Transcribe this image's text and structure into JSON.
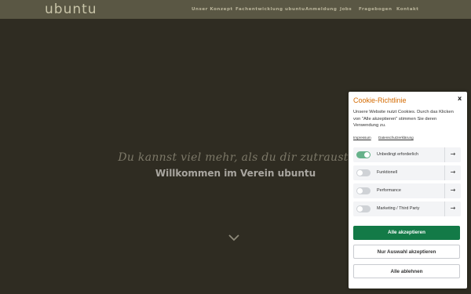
{
  "header": {
    "logo": "ubuntu",
    "nav": [
      "Unser Konzept",
      "Fachentwicklung ubuntu",
      "Anmeldung",
      "Jobs",
      "Fragebogen",
      "Kontakt"
    ]
  },
  "hero": {
    "tagline": "Du kannst viel mehr, als du dir zutraust!",
    "welcome": "Willkommen im Verein ubuntu"
  },
  "cookie": {
    "title": "Cookie-Richtlinie",
    "close": "x",
    "text": "Unsere Website nutzt Cookies. Durch das Klicken von \"Alle akzeptieren\" stimmen Sie deren Verwendung zu.",
    "links": [
      "Impressum",
      "Datenschutzerklärung"
    ],
    "options": [
      {
        "label": "Unbedingt erforderlich",
        "enabled": true
      },
      {
        "label": "Funktionell",
        "enabled": false
      },
      {
        "label": "Performance",
        "enabled": false
      },
      {
        "label": "Marketing / Third Party",
        "enabled": false
      }
    ],
    "arrow": "→",
    "buttons": {
      "accept_all": "Alle akzeptieren",
      "accept_selection": "Nur Auswahl akzeptieren",
      "reject_all": "Alle ablehnen"
    }
  },
  "colors": {
    "topbar": "#5a5744",
    "hero_bg": "#2f2c22",
    "accent_orange": "#d46a00",
    "primary_green": "#137a47"
  }
}
